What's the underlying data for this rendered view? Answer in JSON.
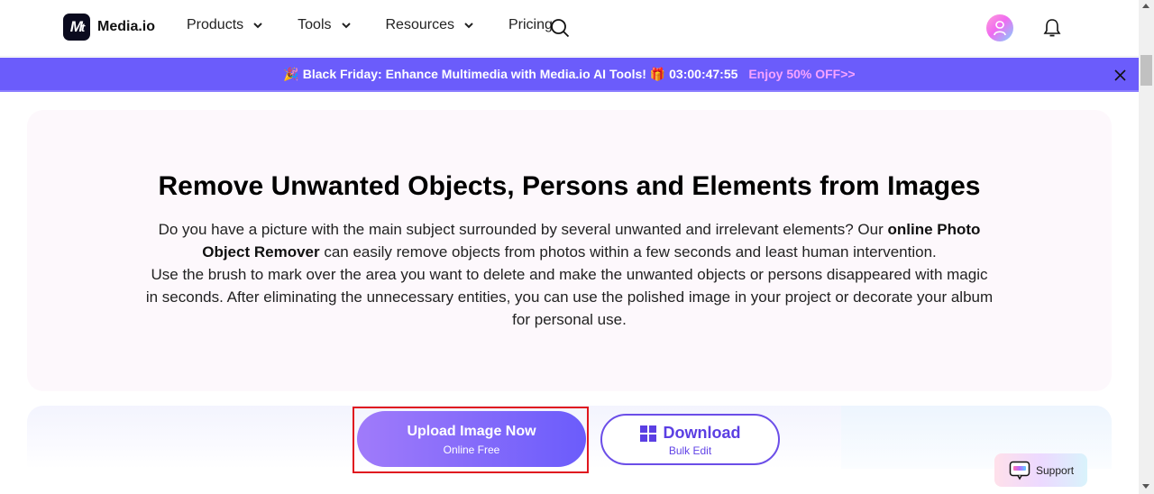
{
  "header": {
    "logo_mark": "M",
    "brand": "Media.io",
    "nav": [
      {
        "label": "Products",
        "has_dropdown": true
      },
      {
        "label": "Tools",
        "has_dropdown": true
      },
      {
        "label": "Resources",
        "has_dropdown": true
      },
      {
        "label": "Pricing",
        "has_dropdown": false
      }
    ],
    "icons": {
      "search": "search-icon",
      "avatar": "user-avatar-icon",
      "notifications": "bell-icon"
    }
  },
  "promo": {
    "lead_emoji": "🎉",
    "text": "Black Friday: Enhance Multimedia with Media.io AI Tools!",
    "gift_emoji": "🎁",
    "countdown": "03:00:47:55",
    "offer": "Enjoy 50% OFF>>",
    "close_icon": "close-icon"
  },
  "hero": {
    "title": "Remove Unwanted Objects, Persons and Elements from Images",
    "desc_p1_a": "Do you have a picture with the main subject surrounded by several unwanted and irrelevant elements? Our ",
    "desc_p1_bold": "online Photo Object Remover",
    "desc_p1_b": " can easily remove objects from photos within a few seconds and least human intervention.",
    "desc_p2": "Use the brush to mark over the area you want to delete and make the unwanted objects or persons disappeared with magic in seconds. After eliminating the unnecessary entities, you can use the polished image in your project or decorate your album for personal use."
  },
  "cta": {
    "upload": {
      "label": "Upload Image Now",
      "sub": "Online Free"
    },
    "download": {
      "label": "Download",
      "sub": "Bulk Edit",
      "icon": "windows-icon"
    }
  },
  "support": {
    "label": "Support"
  },
  "colors": {
    "brand_purple": "#6b5cfb",
    "offer_pink": "#f7a3ff",
    "highlight_red": "#e0161f",
    "hero_bg": "#fdf8fc"
  }
}
